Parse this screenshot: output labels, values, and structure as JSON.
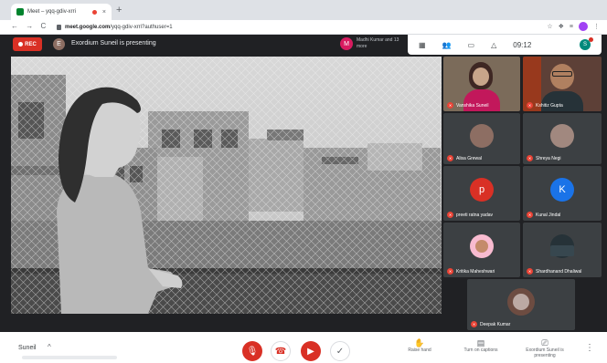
{
  "browser": {
    "tab_title": "Meet – yqq-gdiv-xrri",
    "tab_close": "×",
    "new_tab": "+",
    "nav_icons": "← → C",
    "url_host": "meet.google.com",
    "url_path": "/yqq-gdiv-xrri?authuser=1",
    "ext_icons": [
      "☆",
      "❖",
      "≡"
    ],
    "menu": "⋮"
  },
  "meet": {
    "rec_label": "REC",
    "presenter_initial": "E",
    "presenting_text": "Exordium Suneil is presenting",
    "chip_initial": "M",
    "chip_text": "Madhi Kumar and 13 more",
    "time": "09:12",
    "me_initial": "S"
  },
  "participants": [
    {
      "name": "Vanshika Suneil",
      "initial": "",
      "color": "#6d4c41",
      "kind": "video"
    },
    {
      "name": "Kshitiz Gupta",
      "initial": "",
      "color": "#4e342e",
      "kind": "video"
    },
    {
      "name": "Alisa Grewal",
      "initial": "",
      "color": "#8d6e63",
      "kind": "photo"
    },
    {
      "name": "Shreya Negi",
      "initial": "",
      "color": "#795548",
      "kind": "photo"
    },
    {
      "name": "preeti ratna yadav",
      "initial": "p",
      "color": "#d93025",
      "kind": "letter"
    },
    {
      "name": "Kunal Jindal",
      "initial": "K",
      "color": "#1a73e8",
      "kind": "letter"
    },
    {
      "name": "Kritika Maheshwari",
      "initial": "",
      "color": "#e91e63",
      "kind": "photo"
    },
    {
      "name": "Shardhanand Dhaliwal",
      "initial": "",
      "color": "#455a64",
      "kind": "photo"
    },
    {
      "name": "Deepak Kumar",
      "initial": "",
      "color": "#6d4c41",
      "kind": "photo"
    }
  ],
  "bottom": {
    "meeting_name": "Suneil",
    "caret": "^",
    "raise_hand": "Raise hand",
    "captions": "Turn on captions",
    "present": "Exordium Suneil is presenting",
    "more": "⋮"
  },
  "colors": {
    "end_call": "#d93025",
    "bg": "#202124",
    "tile": "#3c4043"
  }
}
